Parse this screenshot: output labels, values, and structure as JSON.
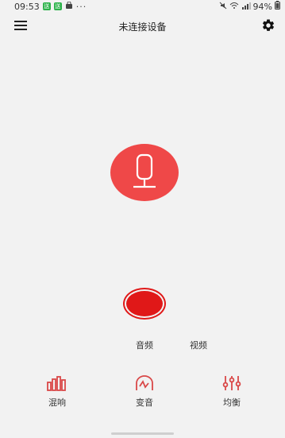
{
  "status": {
    "time": "09:53",
    "app_badge_1": "送",
    "app_badge_2": "送",
    "more": "···",
    "battery": "94%"
  },
  "header": {
    "title": "未连接设备"
  },
  "modes": {
    "audio": "音频",
    "video": "视频"
  },
  "tools": [
    {
      "label": "混响",
      "icon": "reverb-bars-icon"
    },
    {
      "label": "变音",
      "icon": "voice-change-icon"
    },
    {
      "label": "均衡",
      "icon": "equalizer-icon"
    }
  ],
  "colors": {
    "accent": "#ef4848",
    "record": "#e01818"
  }
}
